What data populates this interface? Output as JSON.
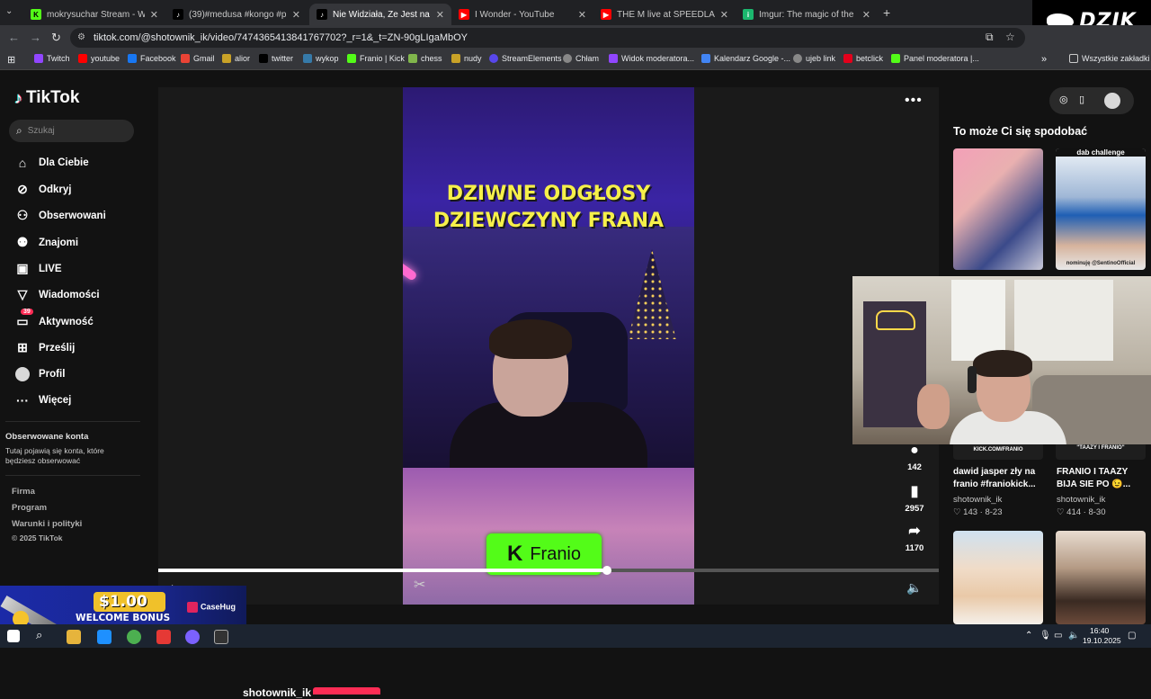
{
  "browser": {
    "tabs": [
      {
        "title": "mokrysuchar Stream - Watch Li",
        "favicon": "kick-icon",
        "color": "#53fc18"
      },
      {
        "title": "(39)#medusa #kongo #pudzian",
        "favicon": "tiktok-icon",
        "color": "#000000"
      },
      {
        "title": "Nie Widziała, Że Jest na Żywo",
        "favicon": "tiktok-icon",
        "color": "#000000",
        "active": true
      },
      {
        "title": "I Wonder - YouTube",
        "favicon": "youtube-icon",
        "color": "#ff0000"
      },
      {
        "title": "THE M live at SPEEDLAND FEST",
        "favicon": "youtube-icon",
        "color": "#ff0000"
      },
      {
        "title": "Imgur: The magic of the Interne",
        "favicon": "imgur-icon",
        "color": "#1bb76e"
      }
    ],
    "url": "tiktok.com/@shotownik_ik/video/7474365413841767702?_r=1&_t=ZN-90gLIgaMbOY",
    "bookmarks": [
      {
        "label": "Twitch",
        "color": "#9146ff"
      },
      {
        "label": "youtube",
        "color": "#ff0000"
      },
      {
        "label": "Facebook",
        "color": "#1877f2"
      },
      {
        "label": "Gmail",
        "color": "#ea4335"
      },
      {
        "label": "alior",
        "color": "#c9a227"
      },
      {
        "label": "twitter",
        "color": "#000000"
      },
      {
        "label": "wykop",
        "color": "#367aa9"
      },
      {
        "label": "Franio | Kick",
        "color": "#53fc18"
      },
      {
        "label": "chess",
        "color": "#81b64c"
      },
      {
        "label": "nudy",
        "color": "#c9a227"
      },
      {
        "label": "StreamElements",
        "color": "#5847eb"
      },
      {
        "label": "Chłam",
        "color": "#888888"
      },
      {
        "label": "Widok moderatora...",
        "color": "#9146ff"
      },
      {
        "label": "Kalendarz Google -...",
        "color": "#4285f4"
      },
      {
        "label": "ujeb link",
        "color": "#888888"
      },
      {
        "label": "betclick",
        "color": "#e3001b"
      },
      {
        "label": "Panel moderatora |...",
        "color": "#53fc18"
      }
    ],
    "bookmarks_all": "Wszystkie zakładki",
    "overlay_logo": "DZIK"
  },
  "sidebar": {
    "logo": "TikTok",
    "search_placeholder": "Szukaj",
    "nav": [
      {
        "label": "Dla Ciebie",
        "icon": "home-icon"
      },
      {
        "label": "Odkryj",
        "icon": "compass-icon"
      },
      {
        "label": "Obserwowani",
        "icon": "person-add-icon"
      },
      {
        "label": "Znajomi",
        "icon": "friends-icon"
      },
      {
        "label": "LIVE",
        "icon": "live-icon"
      },
      {
        "label": "Wiadomości",
        "icon": "send-icon"
      },
      {
        "label": "Aktywność",
        "icon": "inbox-icon",
        "badge": "39"
      },
      {
        "label": "Prześlij",
        "icon": "upload-icon"
      },
      {
        "label": "Profil",
        "icon": "avatar-icon"
      },
      {
        "label": "Więcej",
        "icon": "more-icon"
      }
    ],
    "following_title": "Obserwowane konta",
    "following_text": "Tutaj pojawią się konta, które będziesz obserwować",
    "footer": [
      "Firma",
      "Program",
      "Warunki i polityki"
    ],
    "copyright": "© 2025 TikTok"
  },
  "video": {
    "title_line1": "DZIWNE ODGŁOSY",
    "title_line2": "DZIEWCZYNY FRANA",
    "kick_name": "Franio",
    "progress": 0.575,
    "time": "00:18 / 00:31",
    "comments": "142",
    "saves": "2957",
    "shares": "1170",
    "author": "shotownik_ik"
  },
  "recommendations": {
    "title": "To może Ci się spodobać",
    "items": [
      {
        "caption": "dab challenge",
        "sub": "nominuję @SentinoOfficial"
      },
      {
        "title": "dawid jasper zły na franio #franiokick...",
        "author": "shotownik_ik",
        "likes": "143",
        "date": "8-23",
        "thumb_caption": "KICK.COM/FRANIO"
      },
      {
        "title": "FRANIO I TAAZY BIJA SIE PO 😉...",
        "author": "shotownik_ik",
        "likes": "414",
        "date": "8-30",
        "thumb_caption": "\"TAAZY I FRANIO\""
      }
    ]
  },
  "ad": {
    "amount": "$1.00",
    "subtitle": "WELCOME BONUS",
    "brand": "CaseHug"
  },
  "taskbar": {
    "time": "16:40",
    "date": "19.10.2025"
  }
}
